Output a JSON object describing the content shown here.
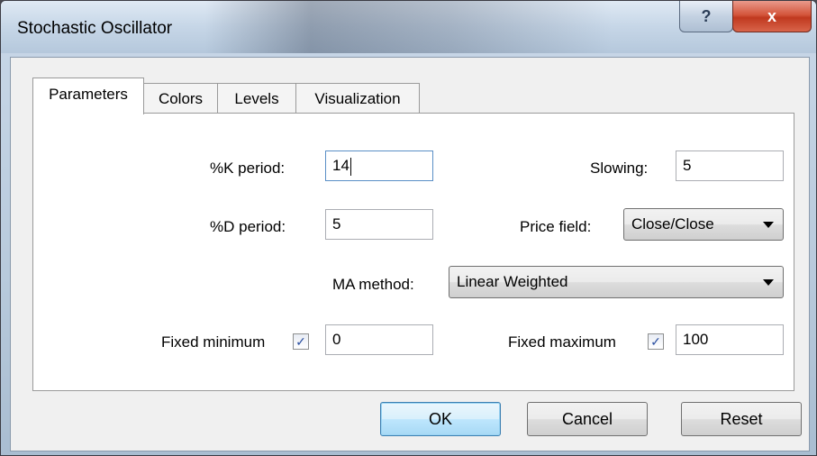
{
  "window": {
    "title": "Stochastic Oscillator",
    "help_label": "?",
    "close_label": "x"
  },
  "tabs": [
    {
      "label": "Parameters",
      "active": true
    },
    {
      "label": "Colors",
      "active": false
    },
    {
      "label": "Levels",
      "active": false
    },
    {
      "label": "Visualization",
      "active": false
    }
  ],
  "params": {
    "k_period": {
      "label": "%K period:",
      "value": "14"
    },
    "slowing": {
      "label": "Slowing:",
      "value": "5"
    },
    "d_period": {
      "label": "%D period:",
      "value": "5"
    },
    "price_field": {
      "label": "Price field:",
      "value": "Close/Close"
    },
    "ma_method": {
      "label": "MA method:",
      "value": "Linear Weighted"
    },
    "fixed_minimum": {
      "label": "Fixed minimum",
      "checked": true,
      "value": "0"
    },
    "fixed_maximum": {
      "label": "Fixed maximum",
      "checked": true,
      "value": "100"
    }
  },
  "buttons": {
    "ok": "OK",
    "cancel": "Cancel",
    "reset": "Reset"
  },
  "check_glyph": "✓"
}
